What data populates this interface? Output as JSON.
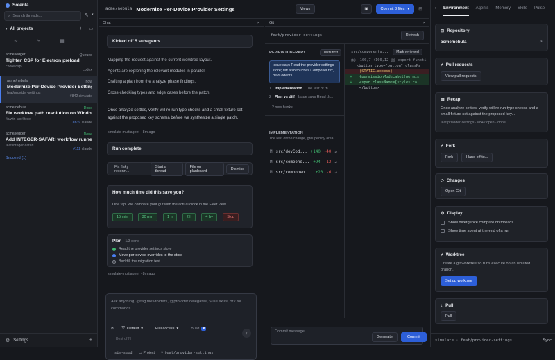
{
  "app": {
    "name": "Solenta",
    "search_placeholder": "Search threads..."
  },
  "sidebar": {
    "all_projects": "All projects",
    "threads": [
      {
        "repo": "acme/ledger",
        "title": "Tighten CSP for Electron preload",
        "branch": "chore/csp",
        "status": "Queued",
        "meta": "codex",
        "status_color": "#9ca0aa"
      },
      {
        "repo": "acme/nebula",
        "title": "Modernize Per-Device Provider Settings",
        "branch": "feat/provider-settings",
        "status": "now",
        "meta": "#842 simulate",
        "status_color": "#9ca0aa"
      },
      {
        "repo": "acme/nebula",
        "title": "Fix worktree path resolution on Windows",
        "branch": "fix/win-worktree",
        "status": "Done",
        "meta_num": "#839",
        "meta_agent": "claude",
        "status_color": "#3fb56e"
      },
      {
        "repo": "acme/ledger",
        "title": "Add INTEGER-SAFARI workflow runner",
        "branch": "feat/integer-safari",
        "status": "Done",
        "meta_num": "#112",
        "meta_agent": "claude",
        "status_color": "#3fb56e"
      }
    ],
    "snoozed": "Snoozed (1)",
    "settings": "Settings"
  },
  "topbar": {
    "repo": "acme/nebula",
    "title": "Modernize Per-Device Provider Settings",
    "views": "Views",
    "commit": "Commit 3 files"
  },
  "chat": {
    "header": "Chat",
    "kicked": "Kicked off 5 subagents",
    "lines": [
      "Mapping the request against the current worktree layout.",
      "Agents are exploring the relevant modules in parallel.",
      "Drafting a plan from the analyze phase findings.",
      "Cross-checking types and edge cases before the patch."
    ],
    "message": "Once analyze settles, verify will re-run type checks and a small fixture set against the proposed key schema before we synthesize a single patch.",
    "source1": "simulate-multiagent · 8m ago",
    "run_complete": "Run complete",
    "suggestions": [
      "Fix flaky reconn...",
      "Start a thread",
      "File on planboard",
      "Dismiss"
    ],
    "save_q": "How much time did this save you?",
    "save_sub": "One tap. We compare your gut with the actual clock in the Fleet view.",
    "times": [
      "15 min",
      "30 min",
      "1 h",
      "2 h",
      "4 h+"
    ],
    "skip": "Skip",
    "plan_title": "Plan",
    "plan_progress": "1/3 done",
    "plan_items": [
      "Read the provider settings store",
      "Move per-device overrides to the store",
      "Backfill the migration test"
    ],
    "source2": "simulate-multiagent · 8m ago",
    "composer_placeholder": "Ask anything, @tag files/folders, @provider delegates, $use skills, or / for commands",
    "mode": "Default",
    "access": "Full access",
    "build": "Build",
    "model": "Best of N",
    "footer": [
      "sim-seed",
      "Project",
      "feat/provider-settings"
    ]
  },
  "git": {
    "header": "Git",
    "branch": "feat/provider-settings",
    "refresh": "Refresh",
    "itinerary": "REVIEW ITINERARY",
    "tests_first": "Tests first",
    "file_head": "src/components...",
    "mark_reviewed": "Mark reviewed",
    "summary": "Issue says Read the provider settings store; diff also touches Composer.tsx, devCoder.ts",
    "steps": [
      {
        "n": "1",
        "label": "Implementation",
        "desc": "The rest of th..."
      },
      {
        "n": "2",
        "label": "Plan vs diff",
        "desc": "Issue says Read th..."
      }
    ],
    "new_hunks": "2 new hunks",
    "impl_title": "IMPLEMENTATION",
    "impl_sub": "The rest of the change, grouped by area.",
    "files": [
      {
        "m": "M",
        "name": "src/devCod...",
        "add": "+140",
        "del": "-40"
      },
      {
        "m": "M",
        "name": "src/compone...",
        "add": "+94",
        "del": "-12"
      },
      {
        "m": "M",
        "name": "src/componen...",
        "add": "+20",
        "del": "-6"
      }
    ],
    "diff": [
      "@@ -100,7 +100,12 @@ export functi",
      "<button type=\"button\" classNa",
      "{STATIC.access}",
      "{permissionModeLabel(permis",
      "<span className={styles.ca",
      "</button>"
    ],
    "commit_placeholder": "Commit message",
    "generate": "Generate",
    "commit": "Commit"
  },
  "right": {
    "tabs": [
      "Environment",
      "Agents",
      "Memory",
      "Skills",
      "Pulse"
    ],
    "repository": "Repository",
    "repo": "acme/nebula",
    "pull_requests": "Pull requests",
    "view_pr": "View pull requests",
    "recap": "Recap",
    "recap_text": "Once analyze settles, verify will re-run type checks and a small fixture set against the proposed key...",
    "recap_meta": "feat/provider-settings · #842 open · done",
    "fork": "Fork",
    "fork_btn": "Fork",
    "handoff": "Hand off to...",
    "changes": "Changes",
    "open_git": "Open Git",
    "display": "Display",
    "opt1": "Show divergence compare on threads",
    "opt2": "Show time spent at the end of a run",
    "worktree": "Worktree",
    "worktree_text": "Create a git worktree so runs execute on an isolated branch.",
    "setup": "Set up worktree",
    "pull": "Pull",
    "pull_btn": "Pull",
    "status": "simulate · feat/provider-settings",
    "sync": "Sync"
  }
}
